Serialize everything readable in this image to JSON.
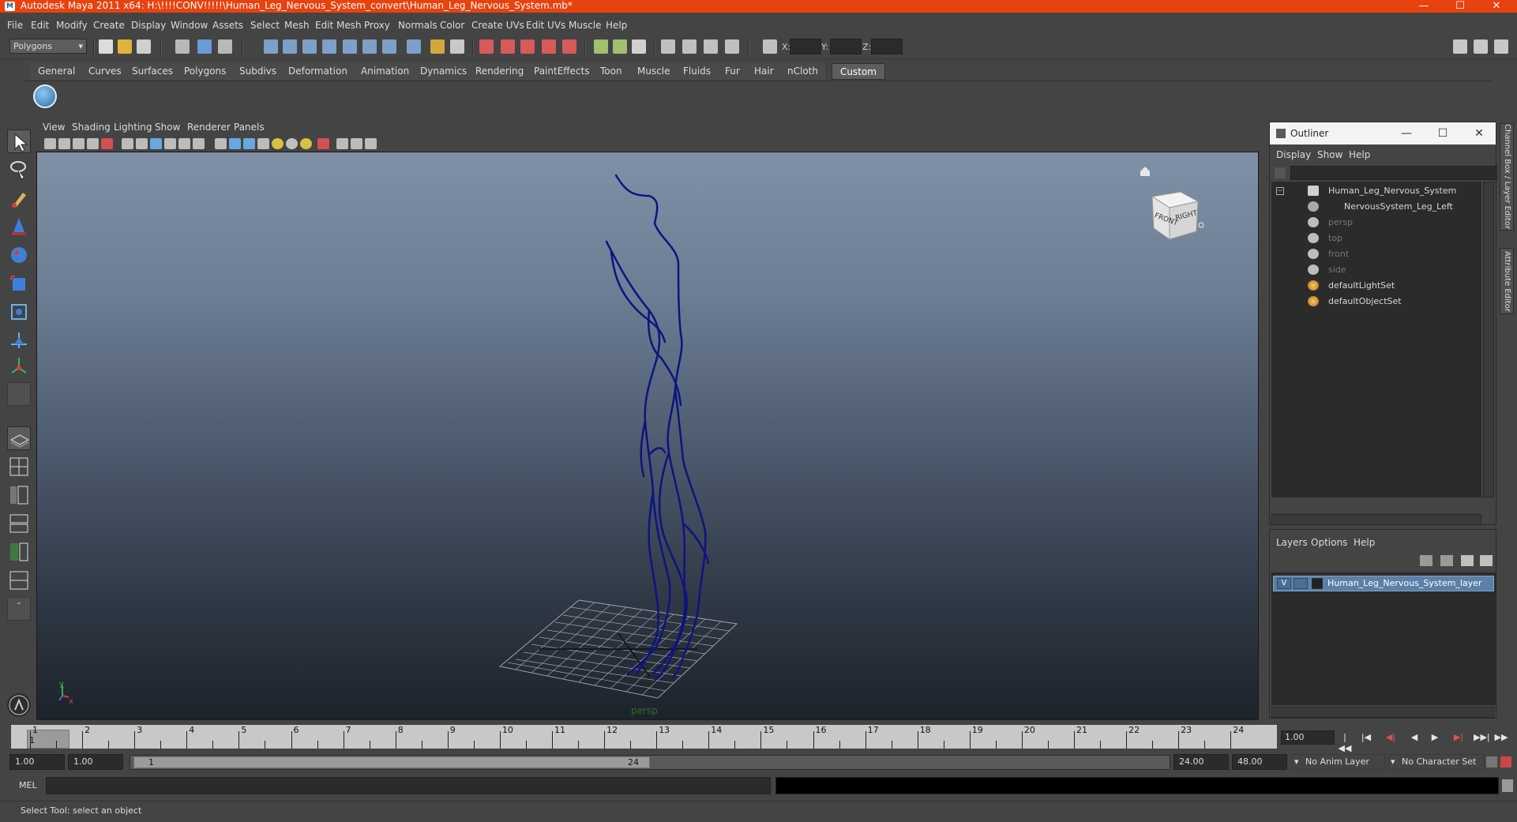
{
  "window": {
    "title": "Autodesk Maya 2011 x64: H:\\!!!!CONV!!!!!\\Human_Leg_Nervous_System_convert\\Human_Leg_Nervous_System.mb*",
    "minimize": "—",
    "maximize": "☐",
    "close": "✕"
  },
  "menubar": [
    "File",
    "Edit",
    "Modify",
    "Create",
    "Display",
    "Window",
    "Assets",
    "Select",
    "Mesh",
    "Edit Mesh",
    "Proxy",
    "Normals",
    "Color",
    "Create UVs",
    "Edit UVs",
    "Muscle",
    "Help"
  ],
  "statusline": {
    "menu_set": "Polygons",
    "x_label": "X:",
    "y_label": "Y:",
    "z_label": "Z:"
  },
  "shelf": {
    "tabs": [
      "General",
      "Curves",
      "Surfaces",
      "Polygons",
      "Subdivs",
      "Deformation",
      "Animation",
      "Dynamics",
      "Rendering",
      "PaintEffects",
      "Toon",
      "Muscle",
      "Fluids",
      "Fur",
      "Hair",
      "nCloth",
      "Custom"
    ],
    "active_tab": "Custom"
  },
  "viewport": {
    "menus": [
      "View",
      "Shading",
      "Lighting",
      "Show",
      "Renderer",
      "Panels"
    ],
    "camera_label": "persp",
    "viewcube_front": "FRONT",
    "viewcube_right": "RIGHT",
    "axis_x": "x",
    "axis_y": "y",
    "model_color": "#0d1480"
  },
  "outliner": {
    "title": "Outliner",
    "menus": [
      "Display",
      "Show",
      "Help"
    ],
    "items": [
      {
        "label": "Human_Leg_Nervous_System",
        "dim": false
      },
      {
        "label": "NervousSystem_Leg_Left",
        "dim": false
      },
      {
        "label": "persp",
        "dim": true
      },
      {
        "label": "top",
        "dim": true
      },
      {
        "label": "front",
        "dim": true
      },
      {
        "label": "side",
        "dim": true
      },
      {
        "label": "defaultLightSet",
        "dim": false
      },
      {
        "label": "defaultObjectSet",
        "dim": false
      }
    ]
  },
  "layers": {
    "menus": [
      "Layers",
      "Options",
      "Help"
    ],
    "layer_name": "Human_Leg_Nervous_System_layer",
    "visible_flag": "V"
  },
  "side_tabs": [
    "Channel Box / Layer Editor",
    "Attribute Editor"
  ],
  "timeline": {
    "ticks": [
      "1",
      "2",
      "3",
      "4",
      "5",
      "6",
      "7",
      "8",
      "9",
      "10",
      "11",
      "12",
      "13",
      "14",
      "15",
      "16",
      "17",
      "18",
      "19",
      "20",
      "21",
      "22",
      "23",
      "24"
    ],
    "current_frame_marker": "1",
    "current_time": "1.00"
  },
  "playback_controls": [
    "|◀◀",
    "|◀",
    "◀|",
    "◀",
    "▶",
    "▶|",
    "▶▶|",
    "▶▶"
  ],
  "range": {
    "start_time": "1.00",
    "playback_start": "1.00",
    "handle_start": "1",
    "handle_end": "24",
    "playback_end": "24.00",
    "end_time": "48.00",
    "anim_layer": "No Anim Layer",
    "character_set": "No Character Set"
  },
  "command_line": {
    "label": "MEL"
  },
  "help_line": {
    "text": "Select Tool: select an object"
  }
}
